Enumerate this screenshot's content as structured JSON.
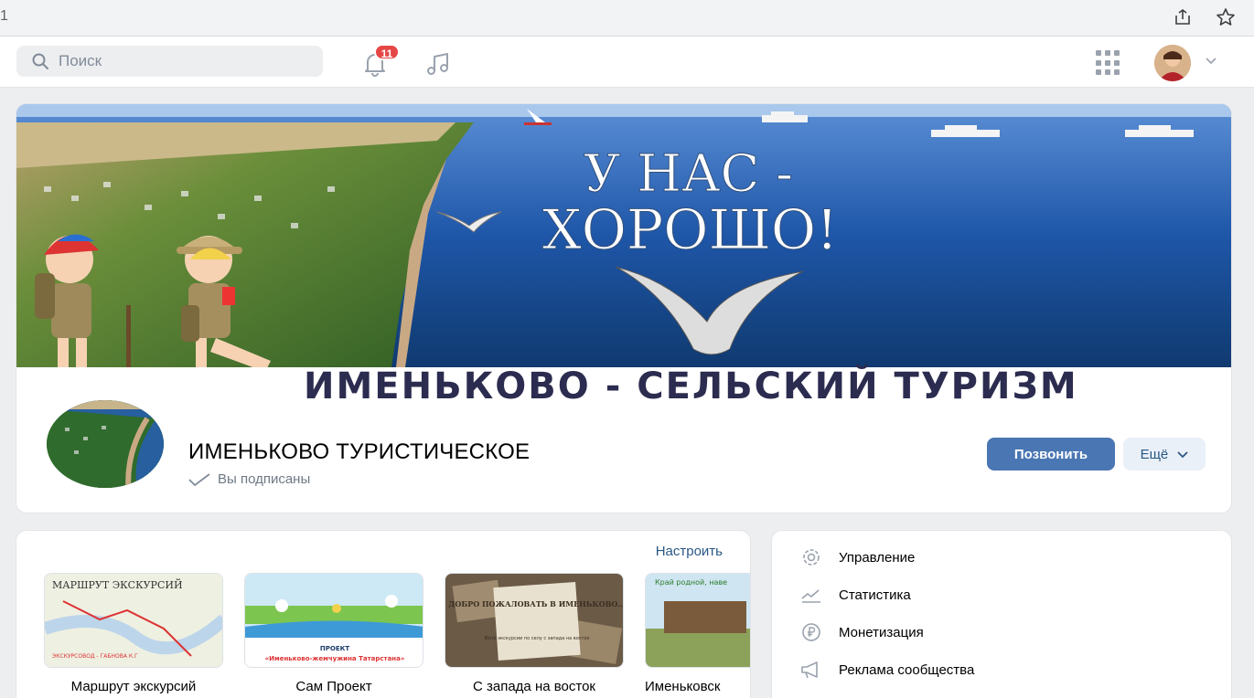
{
  "browser": {
    "tab_number": "1"
  },
  "header": {
    "search_placeholder": "Поиск",
    "notification_count": "11"
  },
  "cover": {
    "headline_line1": "У НАС -",
    "headline_line2": "ХОРОШО!",
    "banner_text": "ИМЕНЬКОВО - СЕЛЬСКИЙ ТУРИЗМ"
  },
  "community": {
    "name": "ИМЕНЬКОВО ТУРИСТИЧЕСКОЕ",
    "status": "Вы подписаны",
    "call_label": "Позвонить",
    "more_label": "Ещё"
  },
  "albums": {
    "configure_label": "Настроить",
    "items": [
      {
        "caption": "Маршрут экскурсий",
        "thumb_title": "МАРШРУТ ЭКСКУРСИЙ",
        "thumb_sub": "ЭКСКУРСОВОД - ГАБНОВА К.Г"
      },
      {
        "caption": "Сам Проект",
        "thumb_title": "ПРОЕКТ",
        "thumb_sub": "«Именьково-жемчужина Татарстана»"
      },
      {
        "caption": "С запада на восток",
        "thumb_title": "ДОБРО ПОЖАЛОВАТЬ В ИМЕНЬКОВО...",
        "thumb_sub": "Фото экскурсии по селу с запада на восток"
      },
      {
        "caption": "Именьковск",
        "thumb_title": "Край родной, наве"
      }
    ]
  },
  "side_menu": {
    "items": [
      {
        "label": "Управление",
        "icon": "gear-icon"
      },
      {
        "label": "Статистика",
        "icon": "chart-icon"
      },
      {
        "label": "Монетизация",
        "icon": "ruble-icon"
      },
      {
        "label": "Реклама сообщества",
        "icon": "megaphone-icon"
      }
    ]
  },
  "colors": {
    "accent": "#4a76b3",
    "link": "#2a5885",
    "badge": "#e64646",
    "banner_text": "#2b2c4f"
  }
}
